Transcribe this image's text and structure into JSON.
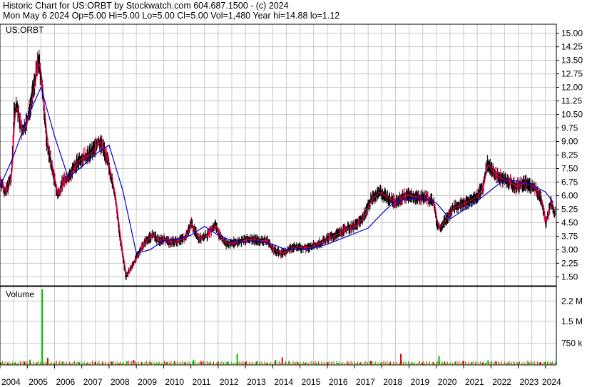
{
  "header": {
    "line1": "Historic Chart for US:ORBT by Stockwatch.com 604.687.1500 - (c) 2024",
    "line2": "Mon May  6 2024   Op=5.00  Hi=5.00  Lo=5.00  Cl=5.00  Vol=1,480  Year hi=14.88  lo=1.12"
  },
  "colors": {
    "price_bars": "#000000",
    "short_ma": "#e8004c",
    "long_ma": "#0000cc",
    "volume_up": "#00bb00",
    "volume_down": "#dd0000",
    "grid": "#c8c8c8"
  },
  "chart_data": [
    {
      "type": "line",
      "title": "US:ORBT",
      "ylim": [
        1.0,
        15.5
      ],
      "yticks": [
        "15.00",
        "14.25",
        "13.50",
        "12.75",
        "12.00",
        "11.25",
        "10.50",
        "9.75",
        "9.00",
        "8.25",
        "7.50",
        "6.75",
        "6.00",
        "5.25",
        "4.50",
        "3.75",
        "3.00",
        "2.25",
        "1.50"
      ],
      "xlim": [
        2004.0,
        2024.4
      ],
      "xticks": [
        "2004",
        "2005",
        "2006",
        "2007",
        "2008",
        "2009",
        "2010",
        "2011",
        "2012",
        "2013",
        "2014",
        "2015",
        "2016",
        "2017",
        "2018",
        "2019",
        "2020",
        "2021",
        "2022",
        "2023",
        "2024"
      ],
      "grid": true,
      "series": [
        {
          "kind": "price",
          "x": [
            2004.0,
            2004.2,
            2004.4,
            2004.5,
            2004.6,
            2004.8,
            2005.0,
            2005.2,
            2005.4,
            2005.5,
            2005.7,
            2005.9,
            2006.1,
            2006.3,
            2006.5,
            2006.7,
            2006.9,
            2007.2,
            2007.4,
            2007.6,
            2007.8,
            2008.0,
            2008.2,
            2008.4,
            2008.6,
            2008.8,
            2009.0,
            2009.2,
            2009.4,
            2009.6,
            2009.8,
            2010.0,
            2010.2,
            2010.5,
            2010.8,
            2011.0,
            2011.1,
            2011.3,
            2011.6,
            2011.9,
            2012.0,
            2012.3,
            2012.6,
            2012.9,
            2013.2,
            2013.5,
            2013.8,
            2014.0,
            2014.3,
            2014.5,
            2014.8,
            2015.0,
            2015.3,
            2015.6,
            2015.9,
            2016.1,
            2016.4,
            2016.7,
            2017.0,
            2017.3,
            2017.6,
            2017.9,
            2018.0,
            2018.2,
            2018.5,
            2018.8,
            2019.0,
            2019.3,
            2019.6,
            2019.9,
            2020.0,
            2020.1,
            2020.2,
            2020.4,
            2020.6,
            2020.9,
            2021.2,
            2021.5,
            2021.7,
            2021.85,
            2022.0,
            2022.3,
            2022.6,
            2022.9,
            2023.2,
            2023.4,
            2023.6,
            2023.7,
            2023.8,
            2024.0,
            2024.1,
            2024.2,
            2024.3
          ],
          "y": [
            6.8,
            6.2,
            7.0,
            10.5,
            11.0,
            9.5,
            10.2,
            11.8,
            13.5,
            12.5,
            9.0,
            7.5,
            6.0,
            6.8,
            7.0,
            7.5,
            8.0,
            8.2,
            8.5,
            9.0,
            8.6,
            7.5,
            6.0,
            3.5,
            1.5,
            2.0,
            2.6,
            3.2,
            3.6,
            3.8,
            3.5,
            3.6,
            3.4,
            3.5,
            3.7,
            4.5,
            4.1,
            3.6,
            3.8,
            4.4,
            3.9,
            3.3,
            3.4,
            3.5,
            3.6,
            3.5,
            3.5,
            3.0,
            2.8,
            2.9,
            3.2,
            3.1,
            3.1,
            3.3,
            3.5,
            3.7,
            3.9,
            4.2,
            4.3,
            4.8,
            5.8,
            6.2,
            6.1,
            5.9,
            5.6,
            6.0,
            6.0,
            5.9,
            5.9,
            5.6,
            4.5,
            4.2,
            4.4,
            4.8,
            5.3,
            5.5,
            5.7,
            6.0,
            6.5,
            7.8,
            7.4,
            7.0,
            6.8,
            6.5,
            6.7,
            6.6,
            6.4,
            6.2,
            6.0,
            4.5,
            5.0,
            5.8,
            5.0
          ]
        },
        {
          "kind": "long_moving_average",
          "x": [
            2004.0,
            2004.5,
            2005.0,
            2005.5,
            2006.0,
            2006.5,
            2007.0,
            2007.5,
            2008.0,
            2008.5,
            2009.0,
            2009.5,
            2010.0,
            2010.5,
            2011.0,
            2011.5,
            2012.0,
            2012.5,
            2013.0,
            2013.5,
            2014.0,
            2014.5,
            2015.0,
            2015.5,
            2016.0,
            2016.5,
            2017.0,
            2017.5,
            2018.0,
            2018.5,
            2019.0,
            2019.5,
            2020.0,
            2020.5,
            2021.0,
            2021.5,
            2022.0,
            2022.5,
            2023.0,
            2023.5,
            2024.0,
            2024.3
          ],
          "y": [
            6.5,
            8.2,
            10.3,
            12.0,
            9.3,
            7.0,
            7.6,
            8.3,
            8.8,
            6.3,
            2.8,
            3.0,
            3.5,
            3.6,
            3.8,
            4.3,
            3.8,
            3.5,
            3.4,
            3.5,
            3.3,
            3.0,
            3.0,
            3.1,
            3.3,
            3.6,
            3.9,
            4.2,
            5.0,
            5.7,
            5.8,
            5.9,
            5.6,
            4.7,
            5.2,
            5.7,
            6.3,
            6.9,
            6.8,
            6.6,
            6.2,
            5.6
          ]
        }
      ]
    },
    {
      "type": "bar",
      "title": "Volume",
      "yticks": [
        "2.2 M",
        "1.5 M",
        "750 k"
      ],
      "ylim": [
        0,
        2700000
      ],
      "x": [
        2004.05,
        2004.3,
        2004.55,
        2004.9,
        2005.1,
        2005.35,
        2005.55,
        2005.75,
        2006.0,
        2006.3,
        2006.6,
        2006.9,
        2007.2,
        2007.5,
        2007.8,
        2008.1,
        2008.4,
        2008.65,
        2008.9,
        2009.2,
        2009.5,
        2009.8,
        2010.1,
        2010.4,
        2010.8,
        2011.1,
        2011.4,
        2011.7,
        2012.0,
        2012.35,
        2012.7,
        2013.0,
        2013.4,
        2013.8,
        2014.1,
        2014.35,
        2014.6,
        2014.9,
        2015.2,
        2015.6,
        2016.0,
        2016.4,
        2016.8,
        2017.2,
        2017.6,
        2018.0,
        2018.3,
        2018.7,
        2019.1,
        2019.5,
        2019.9,
        2020.1,
        2020.3,
        2020.7,
        2021.0,
        2021.3,
        2021.7,
        2021.9,
        2022.2,
        2022.6,
        2023.0,
        2023.4,
        2023.8,
        2024.0,
        2024.2
      ],
      "values": [
        60000,
        50000,
        80000,
        110000,
        180000,
        90000,
        2600000,
        240000,
        60000,
        120000,
        50000,
        90000,
        60000,
        100000,
        70000,
        110000,
        60000,
        130000,
        170000,
        100000,
        120000,
        80000,
        90000,
        140000,
        80000,
        180000,
        110000,
        90000,
        70000,
        120000,
        380000,
        110000,
        120000,
        70000,
        170000,
        260000,
        140000,
        100000,
        80000,
        70000,
        90000,
        70000,
        60000,
        80000,
        140000,
        100000,
        70000,
        380000,
        90000,
        70000,
        80000,
        310000,
        120000,
        90000,
        140000,
        100000,
        80000,
        160000,
        110000,
        70000,
        90000,
        80000,
        90000,
        110000,
        70000
      ],
      "up": [
        true,
        false,
        true,
        false,
        true,
        true,
        true,
        false,
        false,
        true,
        false,
        true,
        false,
        false,
        true,
        false,
        false,
        true,
        false,
        true,
        false,
        true,
        false,
        true,
        false,
        true,
        false,
        true,
        false,
        true,
        true,
        false,
        true,
        false,
        true,
        false,
        true,
        false,
        false,
        true,
        false,
        true,
        false,
        true,
        false,
        true,
        false,
        false,
        true,
        false,
        true,
        true,
        false,
        true,
        false,
        true,
        false,
        true,
        false,
        true,
        false,
        true,
        false,
        true,
        false
      ]
    }
  ],
  "panels": {
    "volume_label": "Volume"
  }
}
